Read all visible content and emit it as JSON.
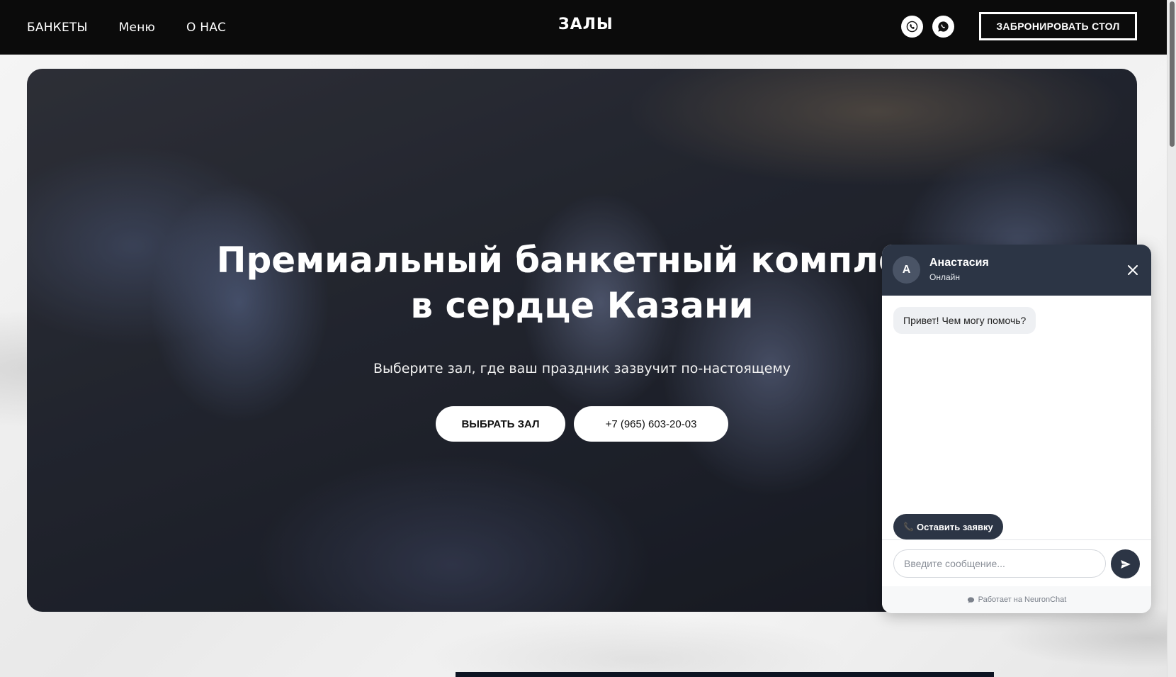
{
  "header": {
    "nav": [
      "БАНКЕТЫ",
      "Меню",
      "О НАС"
    ],
    "logo": "ЗАЛЫ",
    "book_label": "ЗАБРОНИРОВАТЬ СТОЛ"
  },
  "hero": {
    "title_line1": "Премиальный банкетный комплекс",
    "title_line2": "в сердце Казани",
    "subtitle": "Выберите зал, где ваш праздник зазвучит по-настоящему",
    "choose_label": "ВЫБРАТЬ ЗАЛ",
    "phone_label": "+7 (965) 603-20-03"
  },
  "chat": {
    "avatar_letter": "А",
    "agent_name": "Анастасия",
    "status": "Онлайн",
    "greeting": "Привет! Чем могу помочь?",
    "quick_reply": "Оставить заявку",
    "input_placeholder": "Введите сообщение...",
    "footer": "Работает на NeuronChat"
  },
  "colors": {
    "header_bg": "#0b0b0b",
    "chat_accent": "#2c3545"
  },
  "icons": [
    "phone-icon",
    "whatsapp-icon",
    "close-icon",
    "send-icon",
    "chat-bubble-icon"
  ]
}
